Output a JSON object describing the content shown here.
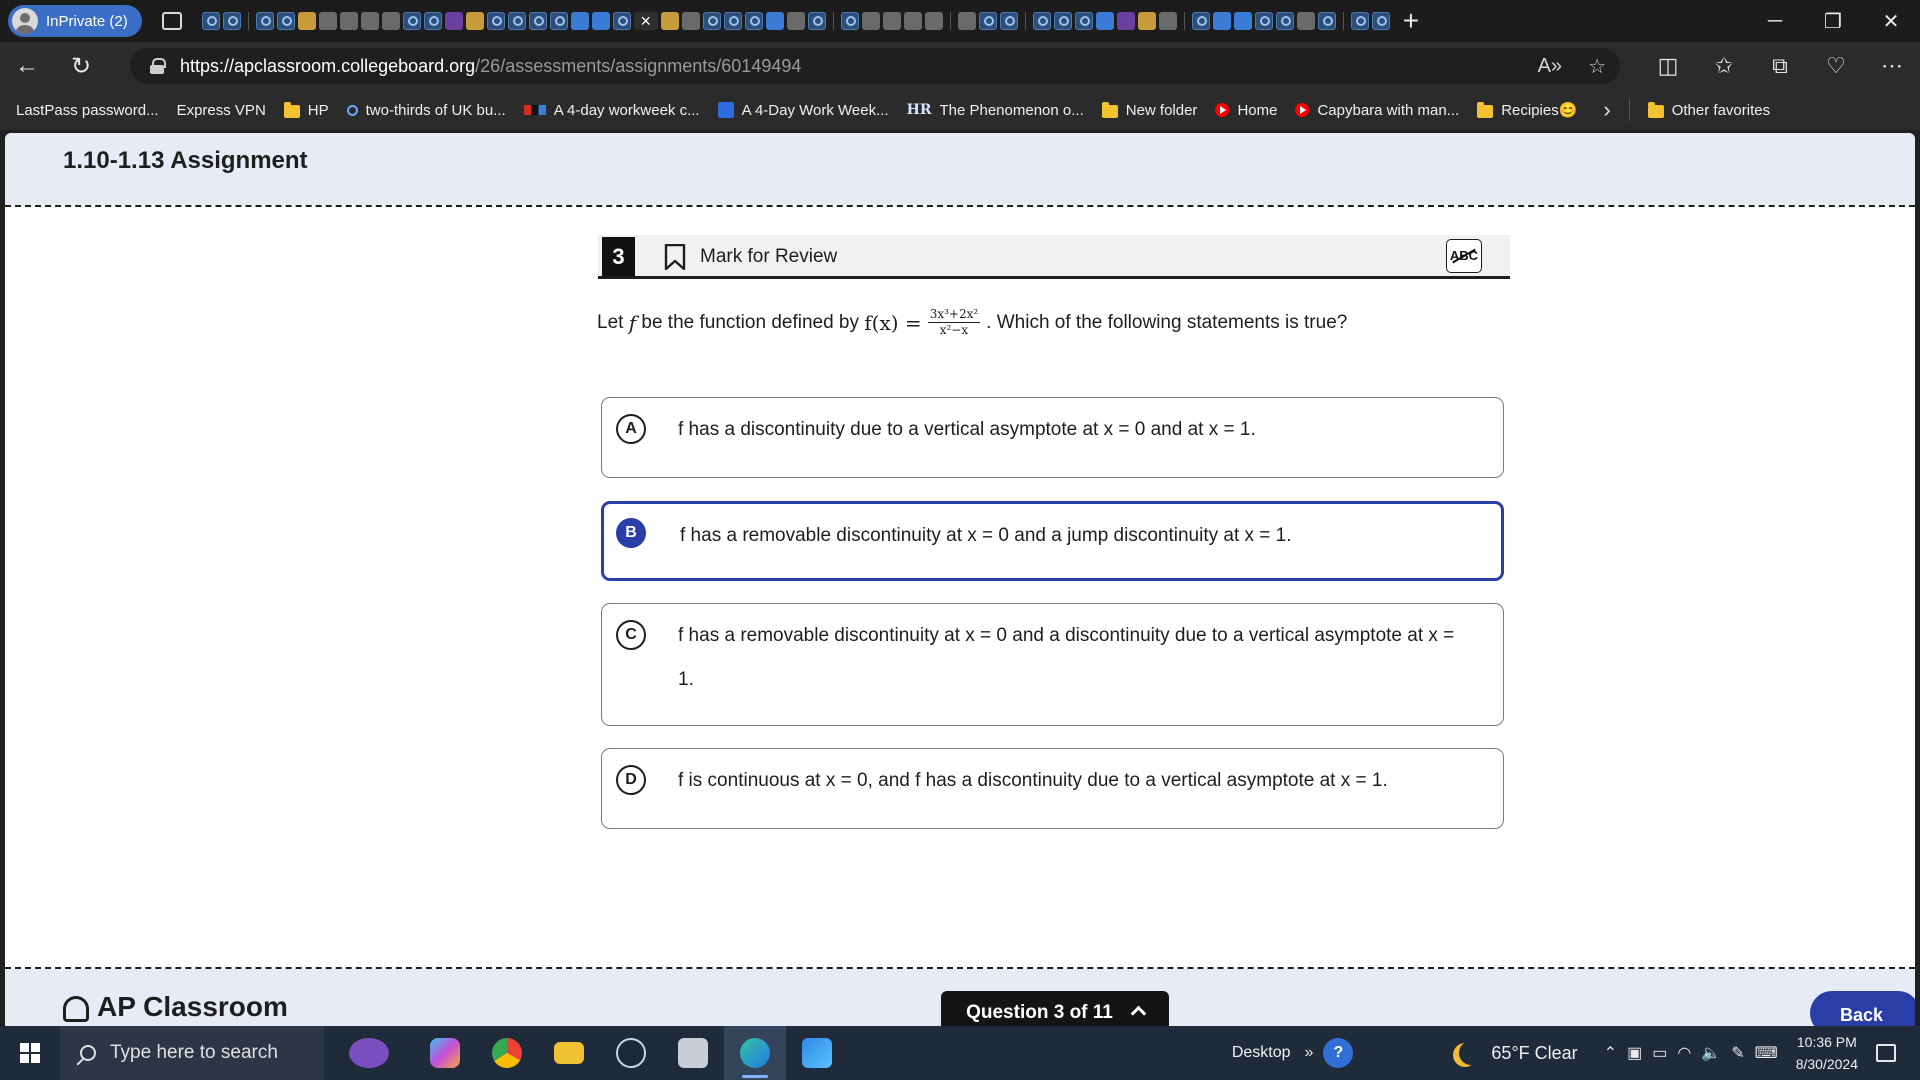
{
  "browser": {
    "profile_label": "InPrivate (2)",
    "url_host": "https://apclassroom.collegeboard.org",
    "url_path": "/26/assessments/assignments/60149494",
    "favorites": [
      {
        "label": "LastPass password...",
        "icon": "page-icon"
      },
      {
        "label": "Express VPN",
        "icon": "page-icon"
      },
      {
        "label": "HP",
        "icon": "folder-icon"
      },
      {
        "label": "two-thirds of UK bu...",
        "icon": "search-icon"
      },
      {
        "label": "A 4-day workweek c...",
        "icon": "npr-icon"
      },
      {
        "label": "A 4-Day Work Week...",
        "icon": "site-icon"
      },
      {
        "label": "The Phenomenon o...",
        "icon": "hr-icon"
      },
      {
        "label": "New folder",
        "icon": "folder-icon"
      },
      {
        "label": "Home",
        "icon": "youtube-icon"
      },
      {
        "label": "Capybara with man...",
        "icon": "youtube-icon"
      },
      {
        "label": "Recipies😊",
        "icon": "folder-icon"
      }
    ],
    "other_favorites": "Other favorites"
  },
  "page": {
    "title": "1.10-1.13 Assignment",
    "question_number": "3",
    "mark_for_review": "Mark for Review",
    "abc_tool": "ABC",
    "stem_before": "Let",
    "stem_f": "f",
    "stem_mid": "be the function defined by",
    "stem_fx": "f(x) =",
    "stem_num": "3x³+2x²",
    "stem_den": "x²−x",
    "stem_after": ". Which of the following statements is true?",
    "choices": [
      {
        "letter": "A",
        "text": "f has a discontinuity due to a vertical asymptote at x = 0 and at x = 1.",
        "selected": false
      },
      {
        "letter": "B",
        "text": "f has a removable discontinuity at x = 0 and a jump discontinuity at x = 1.",
        "selected": true
      },
      {
        "letter": "C",
        "text": "f has a removable discontinuity at x = 0 and a discontinuity due to a vertical asymptote at x = 1.",
        "selected": false
      },
      {
        "letter": "D",
        "text": "f is continuous at x = 0, and f has a discontinuity due to a vertical asymptote at x = 1.",
        "selected": false
      }
    ],
    "footer_logo": "AP Classroom",
    "question_nav": "Question 3 of 11",
    "back_label": "Back"
  },
  "taskbar": {
    "search_placeholder": "Type here to search",
    "desktop_label": "Desktop",
    "weather": "65°F  Clear",
    "time": "10:36 PM",
    "date": "8/30/2024"
  },
  "colors": {
    "accent": "#2a3ea8",
    "header_bg": "#e6ebf5",
    "inprivate_badge": "#3b6fc6"
  }
}
